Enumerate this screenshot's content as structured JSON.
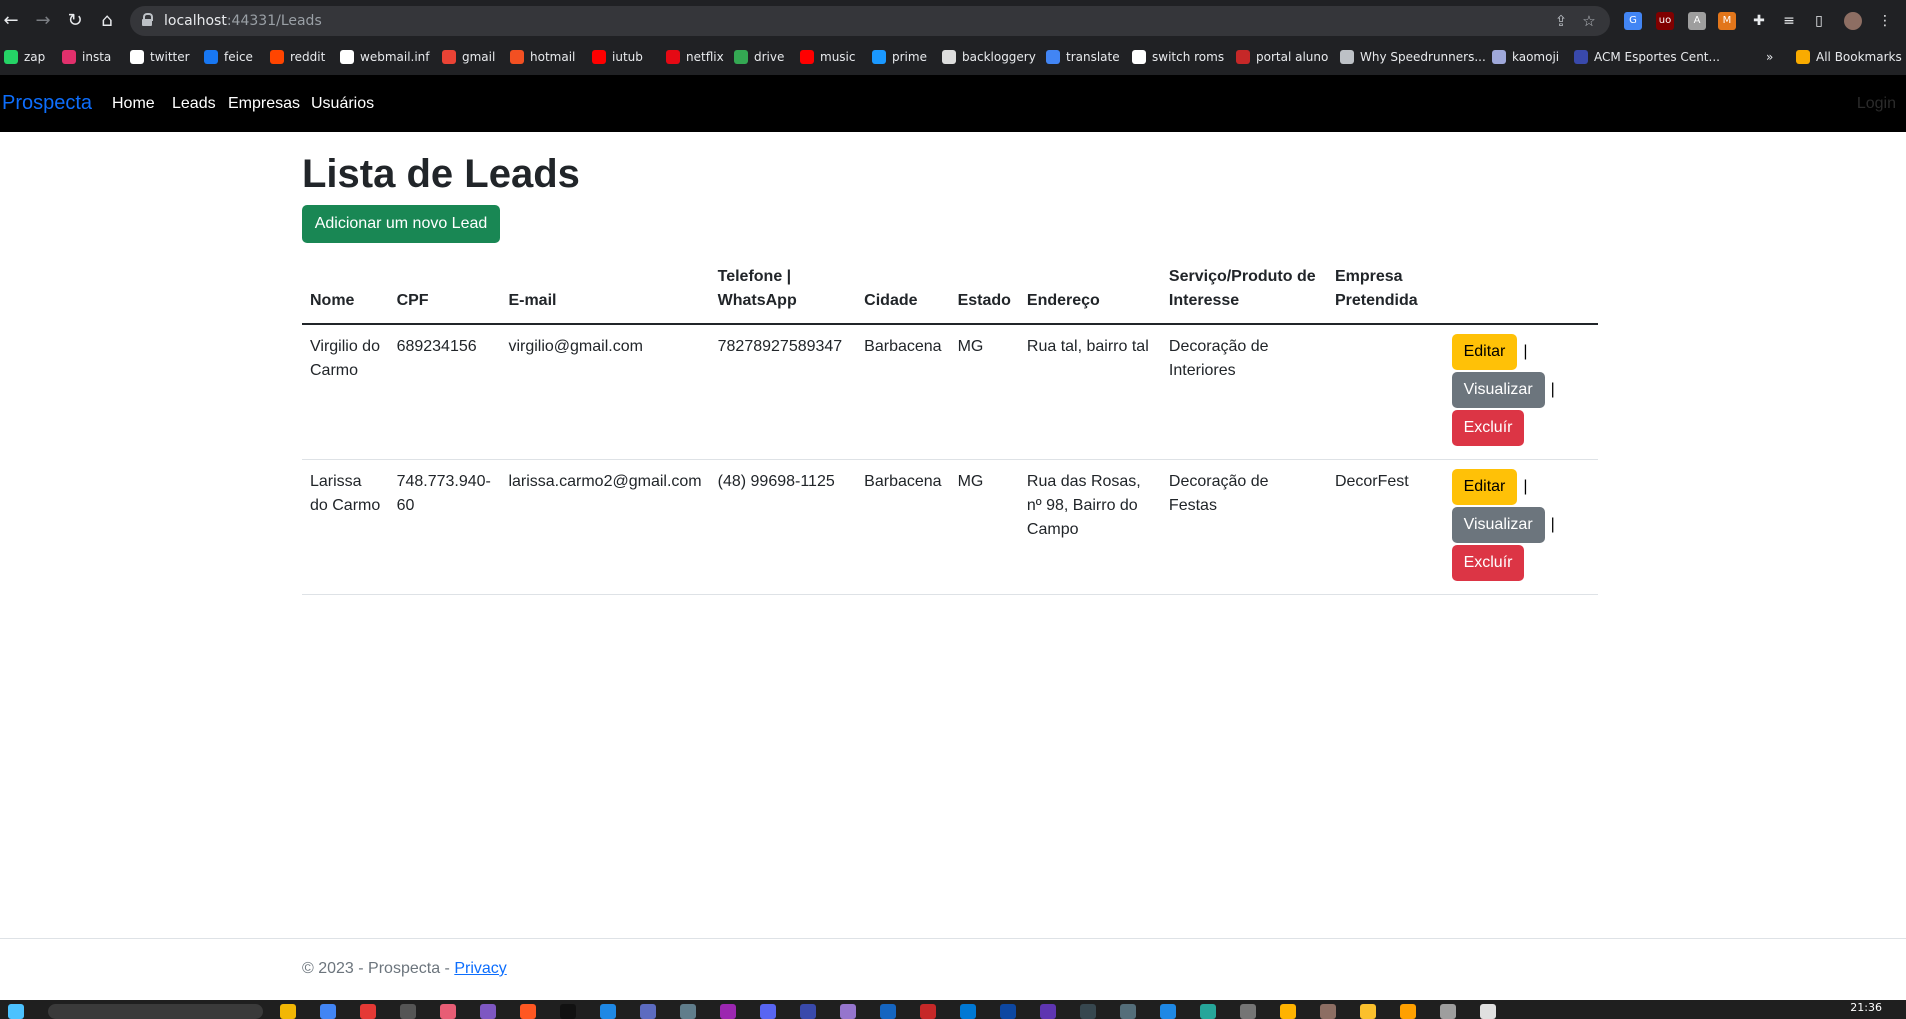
{
  "browser": {
    "url_host": "localhost",
    "url_rest": ":44331/Leads",
    "bookmarks": [
      {
        "label": "zap",
        "color": "#25d366"
      },
      {
        "label": "insta",
        "color": "#e1306c"
      },
      {
        "label": "twitter",
        "color": "#ffffff"
      },
      {
        "label": "feice",
        "color": "#1877f2"
      },
      {
        "label": "reddit",
        "color": "#ff4500"
      },
      {
        "label": "webmail.inf",
        "color": "#ffffff"
      },
      {
        "label": "gmail",
        "color": "#ea4335"
      },
      {
        "label": "hotmail",
        "color": "#f25022"
      },
      {
        "label": "iutub",
        "color": "#ff0000"
      },
      {
        "label": "netflix",
        "color": "#e50914"
      },
      {
        "label": "drive",
        "color": "#34a853"
      },
      {
        "label": "music",
        "color": "#ff0000"
      },
      {
        "label": "prime",
        "color": "#1a98ff"
      },
      {
        "label": "backloggery",
        "color": "#dddddd"
      },
      {
        "label": "translate",
        "color": "#4285f4"
      },
      {
        "label": "switch roms",
        "color": "#ffffff"
      },
      {
        "label": "portal aluno",
        "color": "#c62828"
      },
      {
        "label": "Why Speedrunners...",
        "color": "#bdc1c6"
      },
      {
        "label": "kaomoji",
        "color": "#9fa8da"
      },
      {
        "label": "ACM Esportes Cent...",
        "color": "#3949ab"
      }
    ],
    "more_label": "»",
    "all_bookmarks": "All Bookmarks"
  },
  "navbar": {
    "brand": "Prospecta",
    "links": [
      "Home",
      "Leads",
      "Empresas",
      "Usuários"
    ],
    "login": "Login"
  },
  "main": {
    "title": "Lista de Leads",
    "add_button": "Adicionar um novo Lead",
    "headers": [
      "Nome",
      "CPF",
      "E-mail",
      "Telefone | WhatsApp",
      "Cidade",
      "Estado",
      "Endereço",
      "Serviço/Produto de Interesse",
      "Empresa Pretendida",
      ""
    ],
    "rows": [
      {
        "nome": "Virgilio do Carmo",
        "cpf": "689234156",
        "email": "virgilio@gmail.com",
        "telefone": "78278927589347",
        "cidade": "Barbacena",
        "estado": "MG",
        "endereco": "Rua tal, bairro tal",
        "servico": "Decoração de Interiores",
        "empresa": ""
      },
      {
        "nome": "Larissa do Carmo",
        "cpf": "748.773.940-60",
        "email": "larissa.carmo2@gmail.com",
        "telefone": "(48) 99698-1125",
        "cidade": "Barbacena",
        "estado": "MG",
        "endereco": "Rua das Rosas, nº 98, Bairro do Campo",
        "servico": "Decoração de Festas",
        "empresa": "DecorFest"
      }
    ],
    "actions": {
      "edit": "Editar",
      "view": "Visualizar",
      "delete": "Excluír",
      "separator": "|"
    }
  },
  "footer": {
    "text": "© 2023 - Prospecta - ",
    "privacy": "Privacy"
  },
  "taskbar": {
    "clock": "21:36"
  },
  "colors": {
    "primary": "#0d6efd",
    "success": "#198754",
    "warning": "#ffc107",
    "secondary": "#6c757d",
    "danger": "#dc3545"
  }
}
